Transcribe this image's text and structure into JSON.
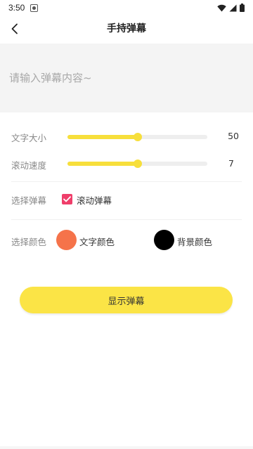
{
  "status_bar": {
    "time": "3:50"
  },
  "header": {
    "title": "手持弹幕",
    "back_icon": "chevron-left-icon"
  },
  "input": {
    "placeholder": "请输入弹幕内容~",
    "value": ""
  },
  "settings": {
    "font_size": {
      "label": "文字大小",
      "value": "50",
      "level": 0.5
    },
    "scroll_speed": {
      "label": "滚动速度",
      "value": "7",
      "level": 0.5
    },
    "danmu_type": {
      "label": "选择弹幕",
      "option_label": "滚动弹幕",
      "checked": true
    },
    "colors": {
      "label": "选择颜色",
      "text_color_label": "文字颜色",
      "text_color": "#f5734a",
      "bg_color_label": "背景颜色",
      "bg_color": "#000000"
    }
  },
  "actions": {
    "show_label": "显示弹幕"
  },
  "theme": {
    "accent": "#fbe446",
    "slider": "#f7df3b",
    "checkbox": "#ef3e6a"
  }
}
